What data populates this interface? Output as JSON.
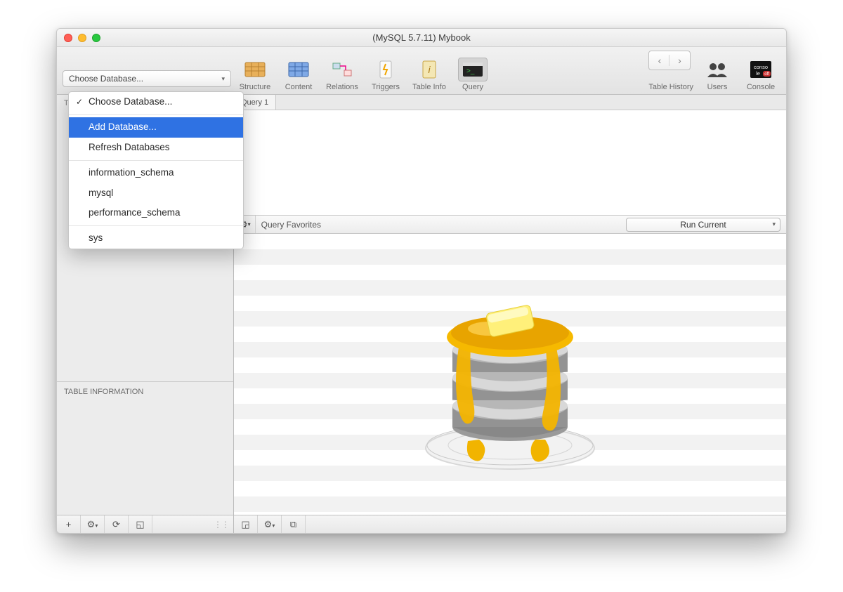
{
  "window": {
    "title": "(MySQL 5.7.11) Mybook"
  },
  "toolbar": {
    "structure": "Structure",
    "content": "Content",
    "relations": "Relations",
    "triggers": "Triggers",
    "table_info": "Table Info",
    "query": "Query",
    "table_history": "Table History",
    "users": "Users",
    "console": "Console"
  },
  "dropdown": {
    "choose": "Choose Database...",
    "add": "Add Database...",
    "refresh": "Refresh Databases",
    "items": [
      "information_schema",
      "mysql",
      "performance_schema"
    ],
    "items2": [
      "sys"
    ]
  },
  "sidebar": {
    "tables_label": "TABLES",
    "info_label": "TABLE INFORMATION"
  },
  "tabs": {
    "t1": "Query 1"
  },
  "querybar": {
    "favorites": "Query Favorites",
    "run": "Run Current"
  }
}
